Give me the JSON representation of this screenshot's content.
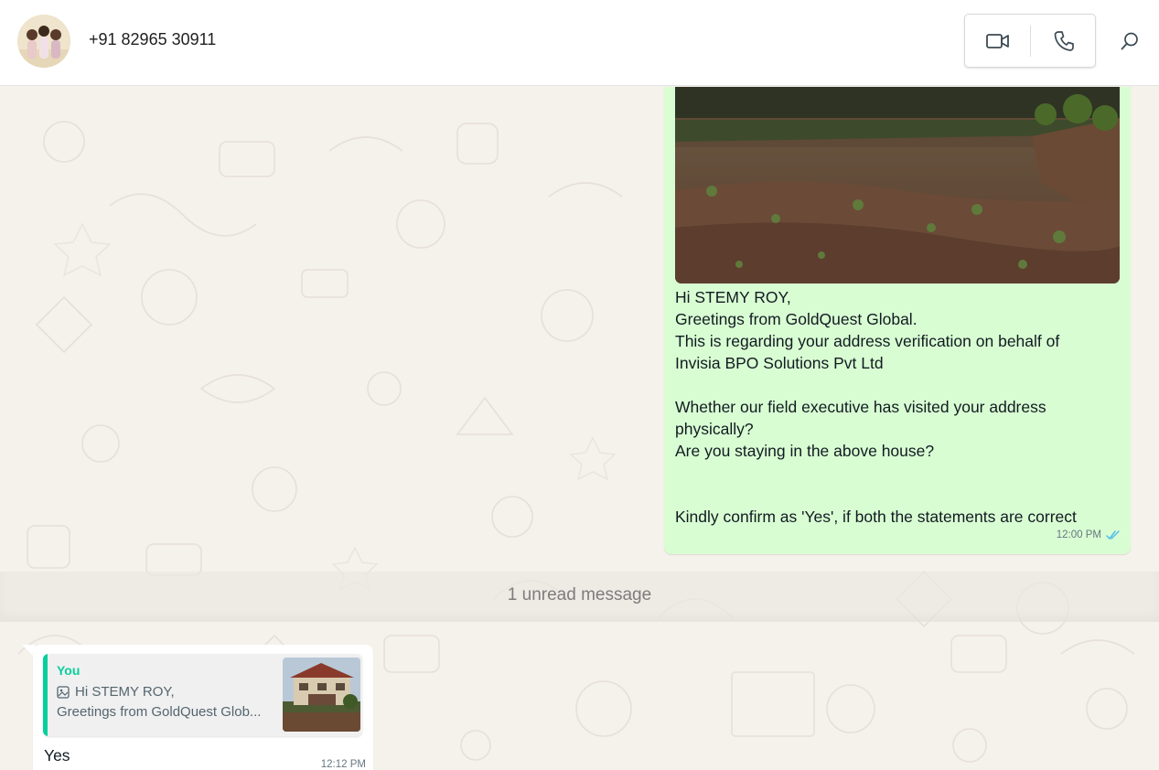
{
  "header": {
    "contact_name": "+91 82965 30911",
    "video_call_icon": "video-camera-icon",
    "voice_call_icon": "phone-icon",
    "search_icon": "search-icon"
  },
  "outgoing_message": {
    "text": "Hi STEMY ROY,\nGreetings from GoldQuest Global.\nThis is regarding your address verification on behalf of\nInvisia BPO Solutions Pvt Ltd\n\nWhether our field executive has visited your address\nphysically?\nAre you staying in the above house?\n\n\nKindly confirm as 'Yes', if both the statements are correct",
    "time": "12:00 PM",
    "status_icon": "double-check-read-icon"
  },
  "unread_divider": {
    "label": "1 unread message"
  },
  "incoming_message": {
    "quote": {
      "author": "You",
      "line1": "Hi STEMY ROY,",
      "line2": "Greetings from GoldQuest Glob...",
      "media_icon": "image-icon"
    },
    "text": "Yes",
    "time": "12:12 PM"
  },
  "colors": {
    "outgoing_bubble": "#d9fdd3",
    "incoming_bubble": "#ffffff",
    "quote_accent": "#06cf9c",
    "read_tick": "#53bdeb",
    "wallpaper": "#f5f1eb"
  }
}
